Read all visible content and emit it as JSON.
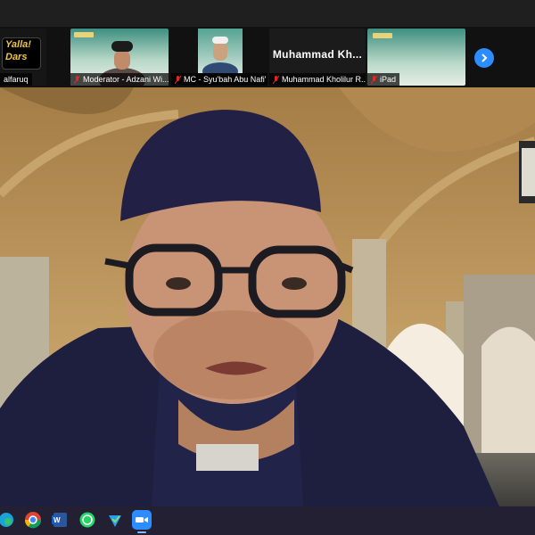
{
  "participants": [
    {
      "label": "alfaruq",
      "tile": "logo",
      "logo_line1": "Yalla!",
      "logo_line2": "Dars",
      "muted": false
    },
    {
      "label": "Moderator - Adzani Wi...",
      "tile": "video",
      "muted": true
    },
    {
      "label": "MC - Syu'bah Abu Nafi'",
      "tile": "video",
      "muted": true
    },
    {
      "label": "Muhammad Kholilur R...",
      "tile": "name",
      "display_name": "Muhammad  Kh...",
      "muted": true
    },
    {
      "label": "iPad",
      "tile": "screen",
      "muted": true
    }
  ],
  "icons": {
    "next_page": "chevron-right-icon",
    "taskbar": [
      "edge-icon",
      "chrome-icon",
      "word-icon",
      "whatsapp-icon",
      "checkmark-app-icon",
      "zoom-icon"
    ]
  },
  "colors": {
    "zoom_blue": "#2d8cff",
    "mute_red": "#e02828",
    "taskbar_bg": "#232034",
    "beret": "#222045",
    "hoodie": "#1e1f3f"
  }
}
